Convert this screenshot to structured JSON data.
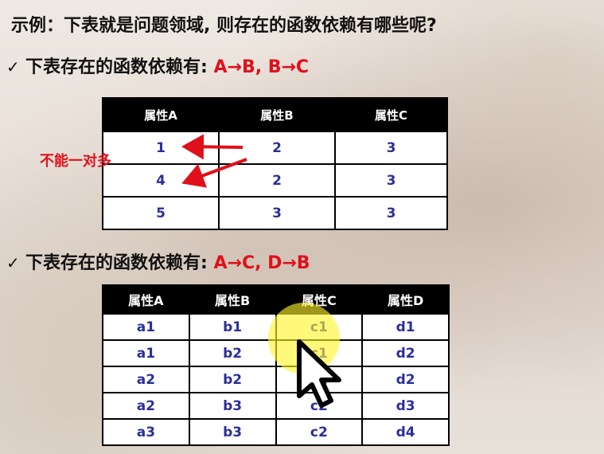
{
  "title": "示例：下表就是问题领域, 则存在的函数依赖有哪些呢?",
  "q1": {
    "check": "✓",
    "text": "下表存在的函数依赖有:",
    "answer": "A→B, B→C"
  },
  "table1": {
    "headers": [
      "属性A",
      "属性B",
      "属性C"
    ],
    "rows": [
      [
        "1",
        "2",
        "3"
      ],
      [
        "4",
        "2",
        "3"
      ],
      [
        "5",
        "3",
        "3"
      ]
    ]
  },
  "annotation": "不能一对多",
  "q2": {
    "check": "✓",
    "text": "下表存在的函数依赖有:",
    "answer": "A→C, D→B"
  },
  "table2": {
    "headers": [
      "属性A",
      "属性B",
      "属性C",
      "属性D"
    ],
    "rows": [
      [
        "a1",
        "b1",
        "c1",
        "d1"
      ],
      [
        "a1",
        "b2",
        "c1",
        "d2"
      ],
      [
        "a2",
        "b2",
        "c2",
        "d2"
      ],
      [
        "a2",
        "b3",
        "c2",
        "d3"
      ],
      [
        "a3",
        "b3",
        "c2",
        "d4"
      ]
    ]
  },
  "colors": {
    "accent_red": "#e0101a",
    "cell_text": "#2a2f9a",
    "header_bg": "#000000",
    "highlight": "#fff428"
  },
  "icons": {
    "cursor": "mouse-pointer-icon",
    "check": "checkmark-icon"
  }
}
